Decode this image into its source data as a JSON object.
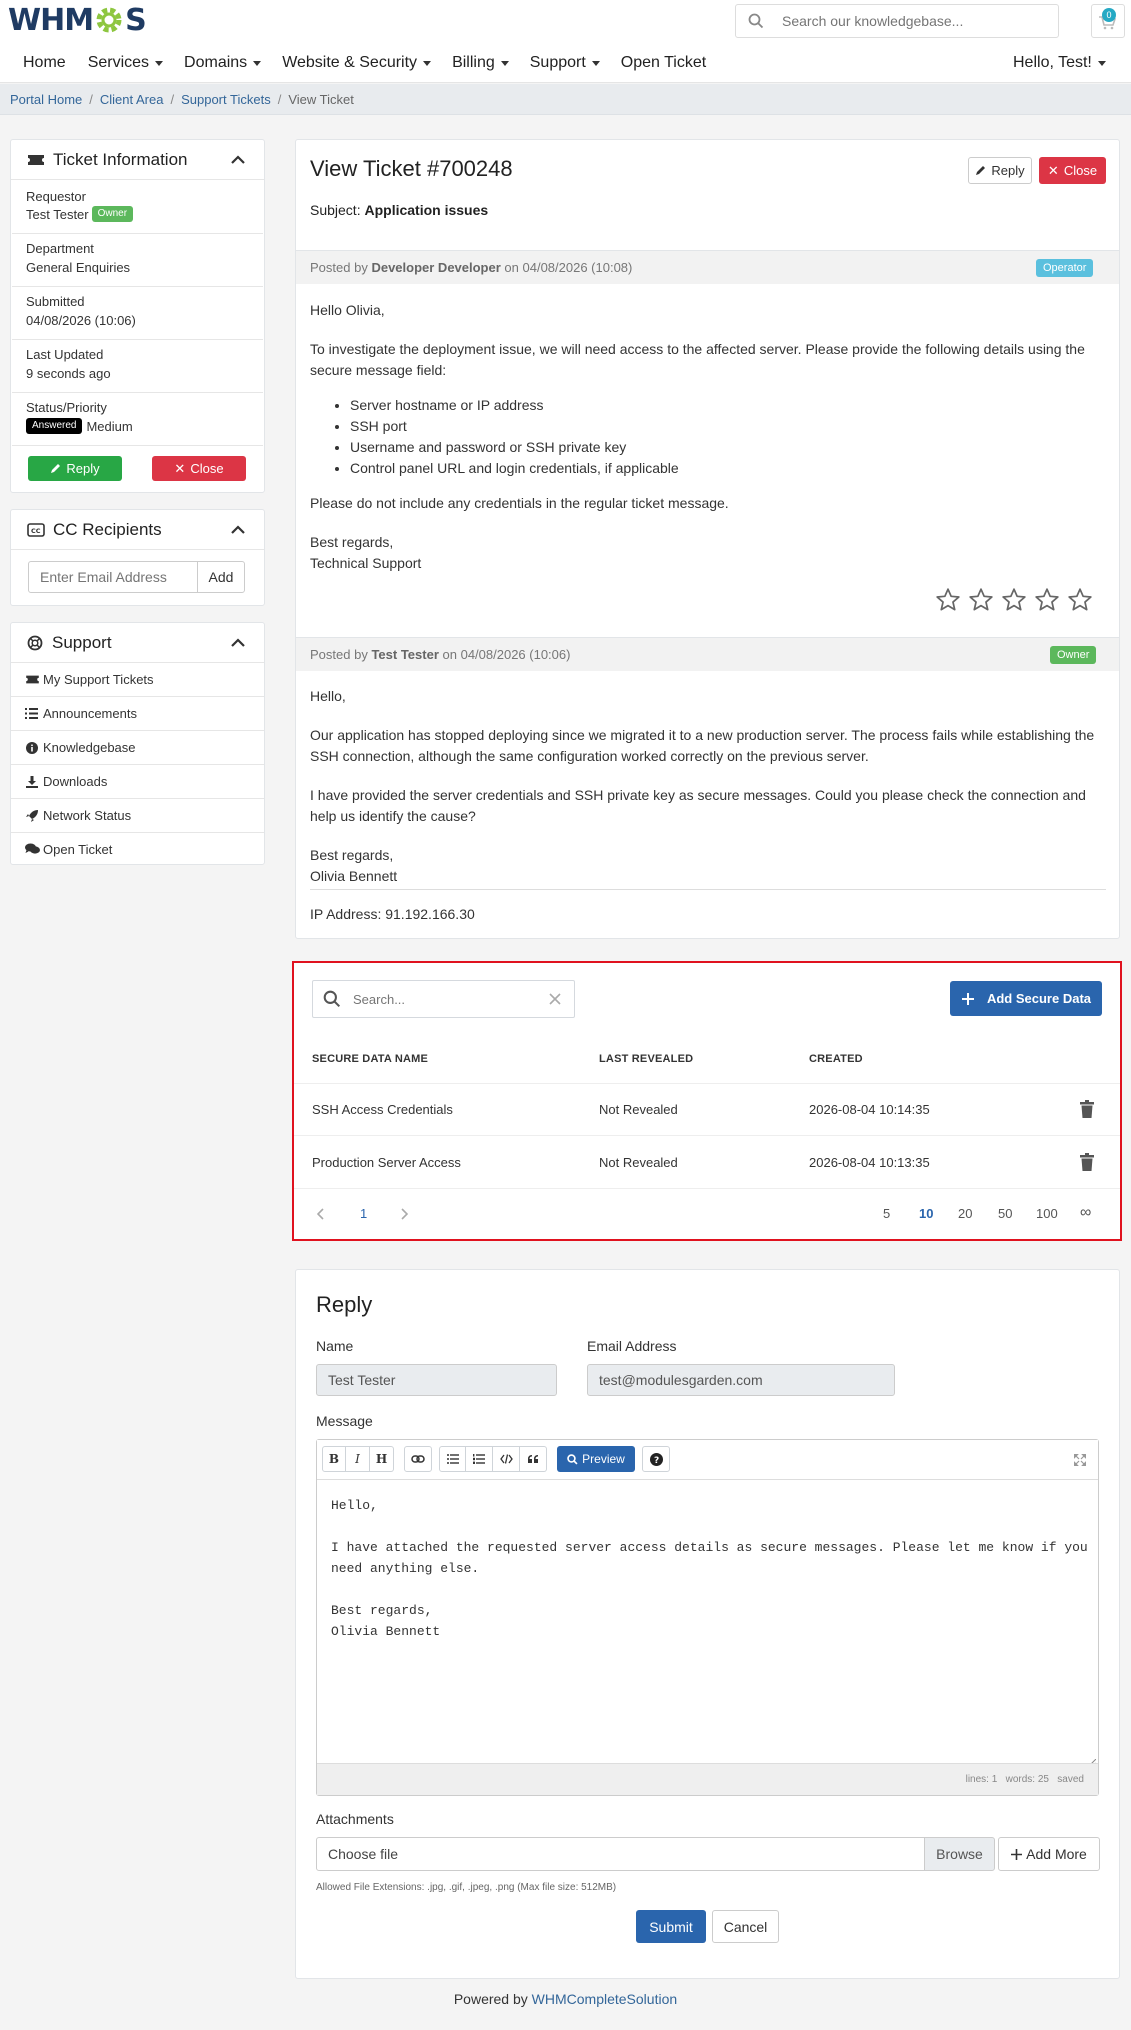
{
  "brand": {
    "logo_text": "WHMCS"
  },
  "header": {
    "search_placeholder": "Search our knowledgebase...",
    "cart_count": "0"
  },
  "nav": {
    "items": [
      {
        "label": "Home"
      },
      {
        "label": "Services"
      },
      {
        "label": "Domains"
      },
      {
        "label": "Website & Security"
      },
      {
        "label": "Billing"
      },
      {
        "label": "Support"
      },
      {
        "label": "Open Ticket"
      }
    ],
    "user_menu": "Hello, Test!"
  },
  "breadcrumb": [
    "Portal Home",
    "Client Area",
    "Support Tickets",
    "View Ticket"
  ],
  "ticket_info": {
    "title": "Ticket Information",
    "requestor_label": "Requestor",
    "requestor": "Test Tester",
    "requestor_badge": "Owner",
    "department_label": "Department",
    "department": "General Enquiries",
    "submitted_label": "Submitted",
    "submitted": "04/08/2026 (10:06)",
    "last_updated_label": "Last Updated",
    "last_updated": "9 seconds ago",
    "status_label": "Status/Priority",
    "status_badge": "Answered",
    "priority": "Medium",
    "reply_button": "Reply",
    "close_button": "Close"
  },
  "cc": {
    "title": "CC Recipients",
    "placeholder": "Enter Email Address",
    "add_button": "Add"
  },
  "support_panel": {
    "title": "Support",
    "items": [
      {
        "label": "My Support Tickets",
        "icon": "ticket-icon"
      },
      {
        "label": "Announcements",
        "icon": "list-icon"
      },
      {
        "label": "Knowledgebase",
        "icon": "info-circle-icon"
      },
      {
        "label": "Downloads",
        "icon": "download-icon"
      },
      {
        "label": "Network Status",
        "icon": "rocket-icon"
      },
      {
        "label": "Open Ticket",
        "icon": "comments-icon"
      }
    ]
  },
  "ticket": {
    "title": "View Ticket #700248",
    "subject_label": "Subject:",
    "subject": "Application issues",
    "reply_button": "Reply",
    "close_button": "Close"
  },
  "messages": [
    {
      "posted_prefix": "Posted by",
      "author": "Developer Developer",
      "posted_on": "on 04/08/2026 (10:08)",
      "badge": "Operator",
      "greeting": "Hello Olivia,",
      "p1": "To investigate the deployment issue, we will need access to the affected server. Please provide the following details using the secure message field:",
      "list": [
        "Server hostname or IP address",
        "SSH port",
        "Username and password or SSH private key",
        "Control panel URL and login credentials, if applicable"
      ],
      "p2": "Please do not include any credentials in the regular ticket message.",
      "sign1": "Best regards,",
      "sign2": "Technical Support",
      "rating": 0
    },
    {
      "posted_prefix": "Posted by",
      "author": "Test Tester",
      "posted_on": "on 04/08/2026 (10:06)",
      "badge": "Owner",
      "greeting": "Hello,",
      "p1": "Our application has stopped deploying since we migrated it to a new production server. The process fails while establishing the SSH connection, although the same configuration worked correctly on the previous server.",
      "p2": "I have provided the server credentials and SSH private key as secure messages. Could you please check the connection and help us identify the cause?",
      "sign1": "Best regards,",
      "sign2": "Olivia Bennett",
      "ip": "IP Address: 91.192.166.30"
    }
  ],
  "secure_data": {
    "search_placeholder": "Search...",
    "add_button": "Add Secure Data",
    "columns": [
      "SECURE DATA NAME",
      "LAST REVEALED",
      "CREATED"
    ],
    "rows": [
      {
        "name": "SSH Access Credentials",
        "last_revealed": "Not Revealed",
        "created": "2026-08-04 10:14:35"
      },
      {
        "name": "Production Server Access",
        "last_revealed": "Not Revealed",
        "created": "2026-08-04 10:13:35"
      }
    ],
    "page": "1",
    "page_sizes": [
      "5",
      "10",
      "20",
      "50",
      "100",
      "∞"
    ],
    "active_page_size": "10"
  },
  "reply": {
    "title": "Reply",
    "name_label": "Name",
    "name_value": "Test Tester",
    "email_label": "Email Address",
    "email_value": "test@modulesgarden.com",
    "message_label": "Message",
    "preview_button": "Preview",
    "message_text": "Hello,\n\nI have attached the requested server access details as secure messages. Please let me know if you\nneed anything else.\n\nBest regards,\nOlivia Bennett",
    "status": "lines: 1   words: 25   saved",
    "attachments_label": "Attachments",
    "choose_file": "Choose file",
    "browse_button": "Browse",
    "add_more_button": "Add More",
    "allowed_ext": "Allowed File Extensions: .jpg, .gif, .jpeg, .png (Max file size: 512MB)",
    "submit_button": "Submit",
    "cancel_button": "Cancel"
  },
  "footer": {
    "prefix": "Powered by",
    "link": "WHMCompleteSolution"
  },
  "colors": {
    "primary": "#336699",
    "success": "#28a745",
    "danger": "#dc3545",
    "operator": "#5bc0de",
    "owner": "#5cb85c",
    "button_blue": "#2a65ad",
    "highlight": "#e0121f"
  }
}
